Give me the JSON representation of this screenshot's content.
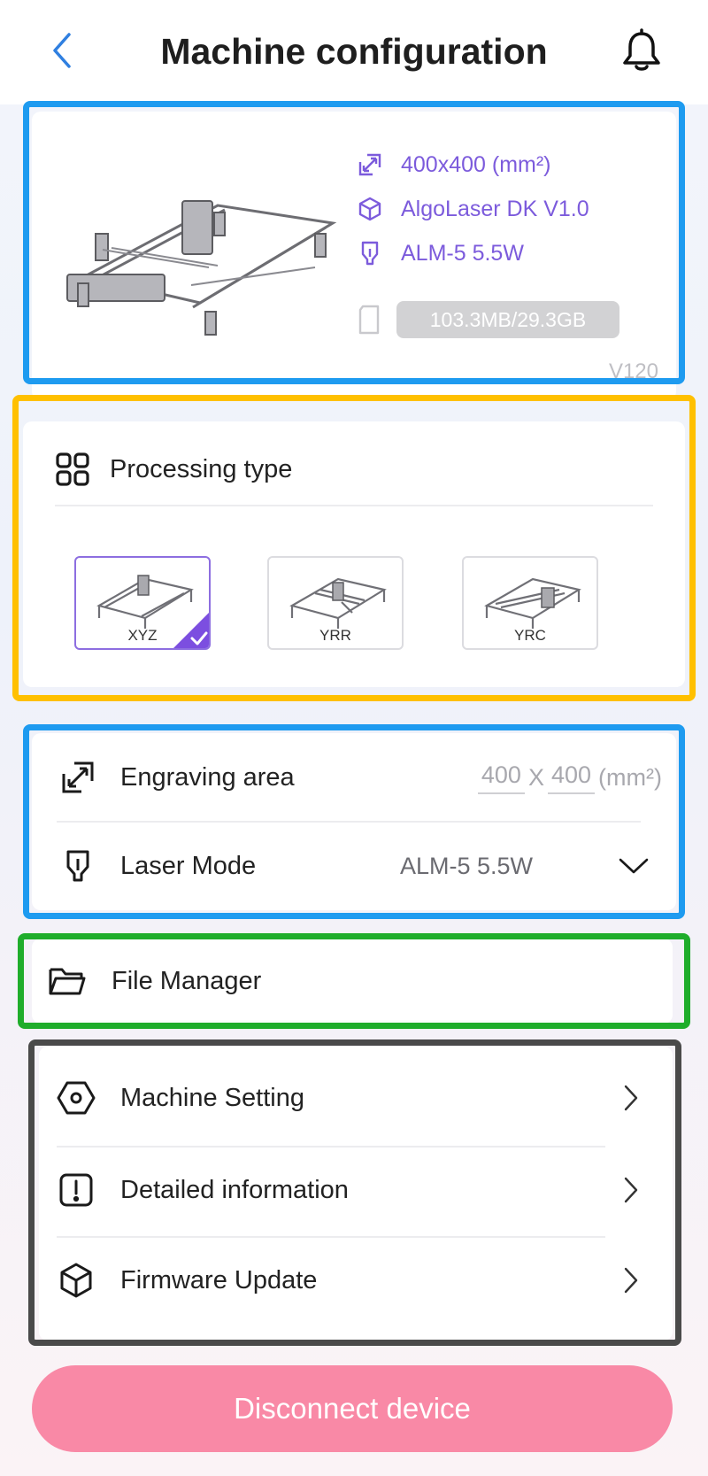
{
  "header": {
    "title": "Machine configuration",
    "back_icon": "chevron-left-icon",
    "notification_icon": "bell-icon"
  },
  "device": {
    "specs": [
      {
        "icon": "resize-icon",
        "text": "400x400 (mm²)"
      },
      {
        "icon": "cube-icon",
        "text": "AlgoLaser DK V1.0"
      },
      {
        "icon": "laser-head-icon",
        "text": "ALM-5 5.5W"
      }
    ],
    "storage": "103.3MB/29.3GB",
    "storage_icon": "sd-card-icon",
    "version": "V120"
  },
  "processing": {
    "title": "Processing type",
    "icon": "grid-icon",
    "options": [
      {
        "label": "XYZ",
        "selected": true
      },
      {
        "label": "YRR",
        "selected": false
      },
      {
        "label": "YRC",
        "selected": false
      }
    ]
  },
  "engraving": {
    "area_label": "Engraving area",
    "area_width": "400",
    "area_x": "X",
    "area_height": "400",
    "area_unit": "(mm²)",
    "laser_label": "Laser Mode",
    "laser_value": "ALM-5 5.5W"
  },
  "file_manager": {
    "label": "File Manager",
    "icon": "folder-icon"
  },
  "settings": {
    "items": [
      {
        "label": "Machine Setting",
        "icon": "hex-nut-icon"
      },
      {
        "label": "Detailed information",
        "icon": "info-exclamation-icon"
      },
      {
        "label": "Firmware Update",
        "icon": "cube-outline-icon"
      }
    ]
  },
  "disconnect_label": "Disconnect device",
  "colors": {
    "accent_purple": "#7c5bdc",
    "disconnect_pink": "#f989a6",
    "frame_blue": "#1e9bf0",
    "frame_yellow": "#ffc000",
    "frame_green": "#1fad2b",
    "frame_dark": "#4a4a4a",
    "back_blue": "#2f7fe0"
  }
}
